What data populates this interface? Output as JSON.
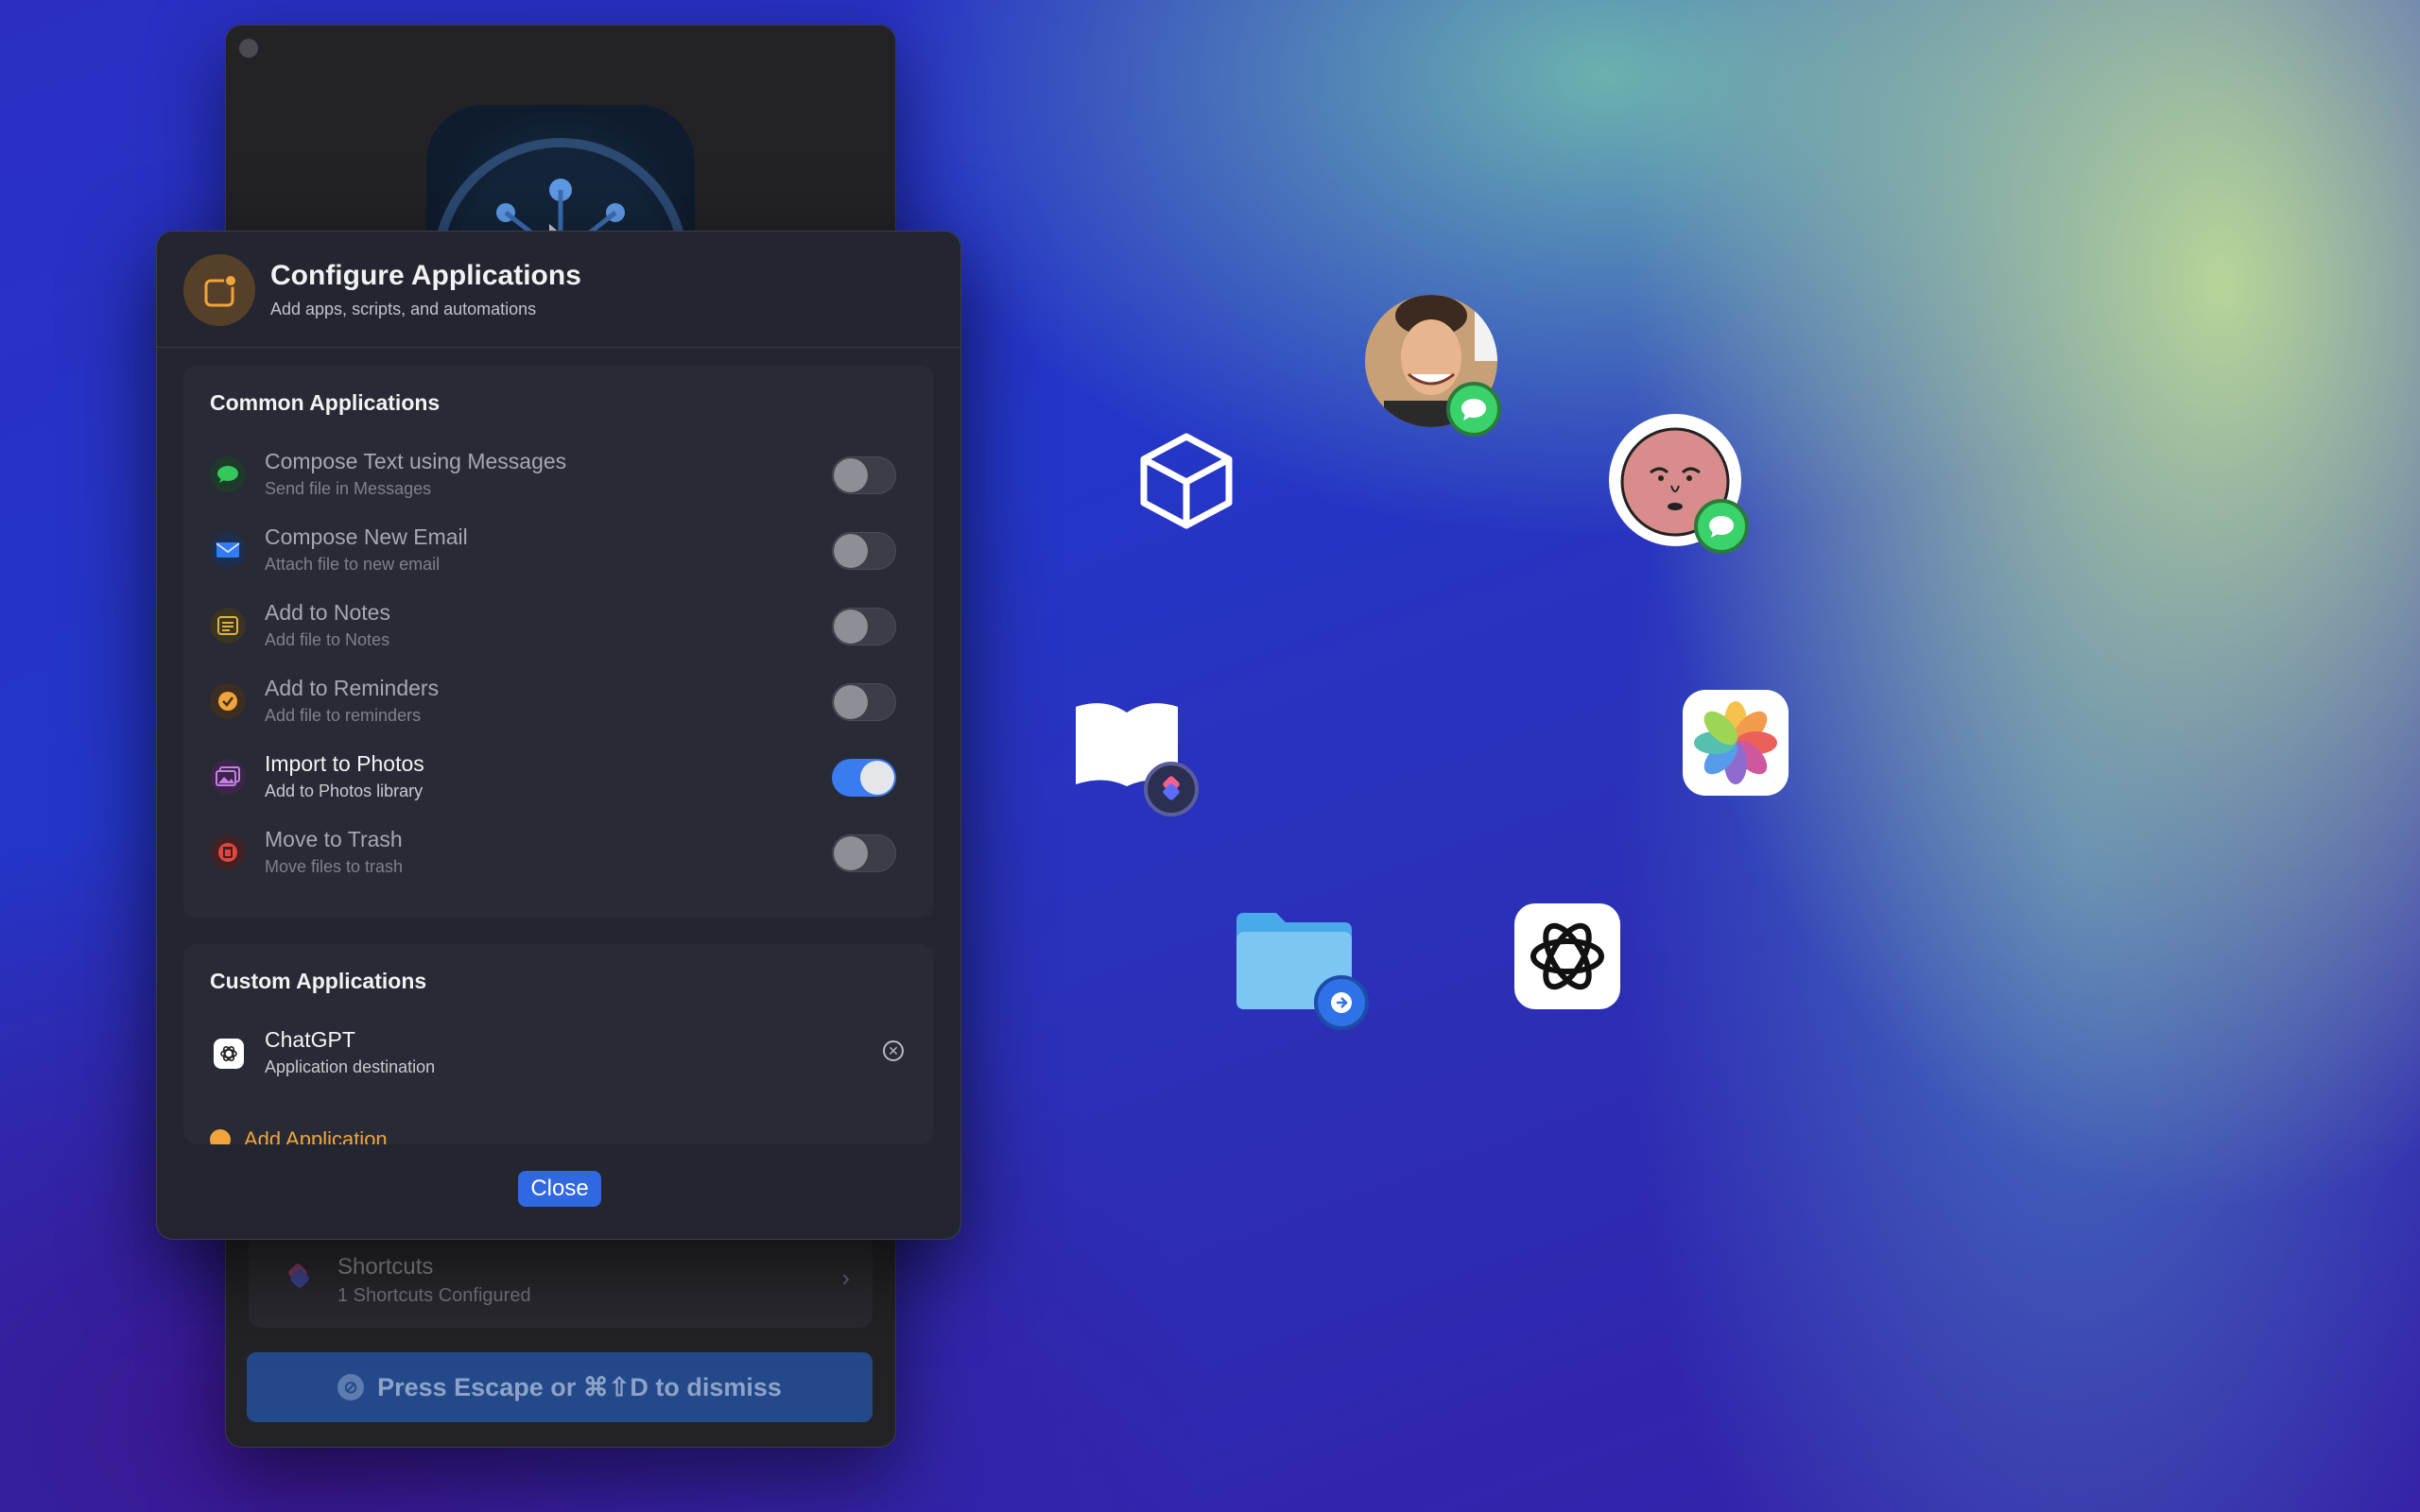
{
  "dialog": {
    "title": "Configure Applications",
    "subtitle": "Add apps, scripts, and automations",
    "close_label": "Close"
  },
  "common": {
    "title": "Common Applications",
    "items": [
      {
        "title": "Compose Text using Messages",
        "subtitle": "Send file in Messages",
        "enabled": false,
        "icon": "messages-icon",
        "color": "#34c759"
      },
      {
        "title": "Compose New Email",
        "subtitle": "Attach file to new email",
        "enabled": false,
        "icon": "mail-icon",
        "color": "#2f7cf6"
      },
      {
        "title": "Add to Notes",
        "subtitle": "Add file to Notes",
        "enabled": false,
        "icon": "notes-icon",
        "color": "#e0b23c"
      },
      {
        "title": "Add to Reminders",
        "subtitle": "Add file to reminders",
        "enabled": false,
        "icon": "reminders-icon",
        "color": "#f0a43a"
      },
      {
        "title": "Import to Photos",
        "subtitle": "Add to Photos library",
        "enabled": true,
        "icon": "photos-icon",
        "color": "#b45ad8"
      },
      {
        "title": "Move to Trash",
        "subtitle": "Move files to trash",
        "enabled": false,
        "icon": "trash-icon",
        "color": "#e5453b"
      }
    ]
  },
  "custom": {
    "title": "Custom Applications",
    "items": [
      {
        "title": "ChatGPT",
        "subtitle": "Application destination",
        "icon": "chatgpt-icon"
      }
    ],
    "add_label": "Add Application"
  },
  "background_window": {
    "shortcuts_title": "Shortcuts",
    "shortcuts_subtitle": "1 Shortcuts Configured",
    "dismiss_label": "Press Escape or ⌘⇧D to dismiss"
  },
  "colors": {
    "accent": "#3a7bf0",
    "dialog_bg": "#232530",
    "section_bg": "#282a35"
  }
}
